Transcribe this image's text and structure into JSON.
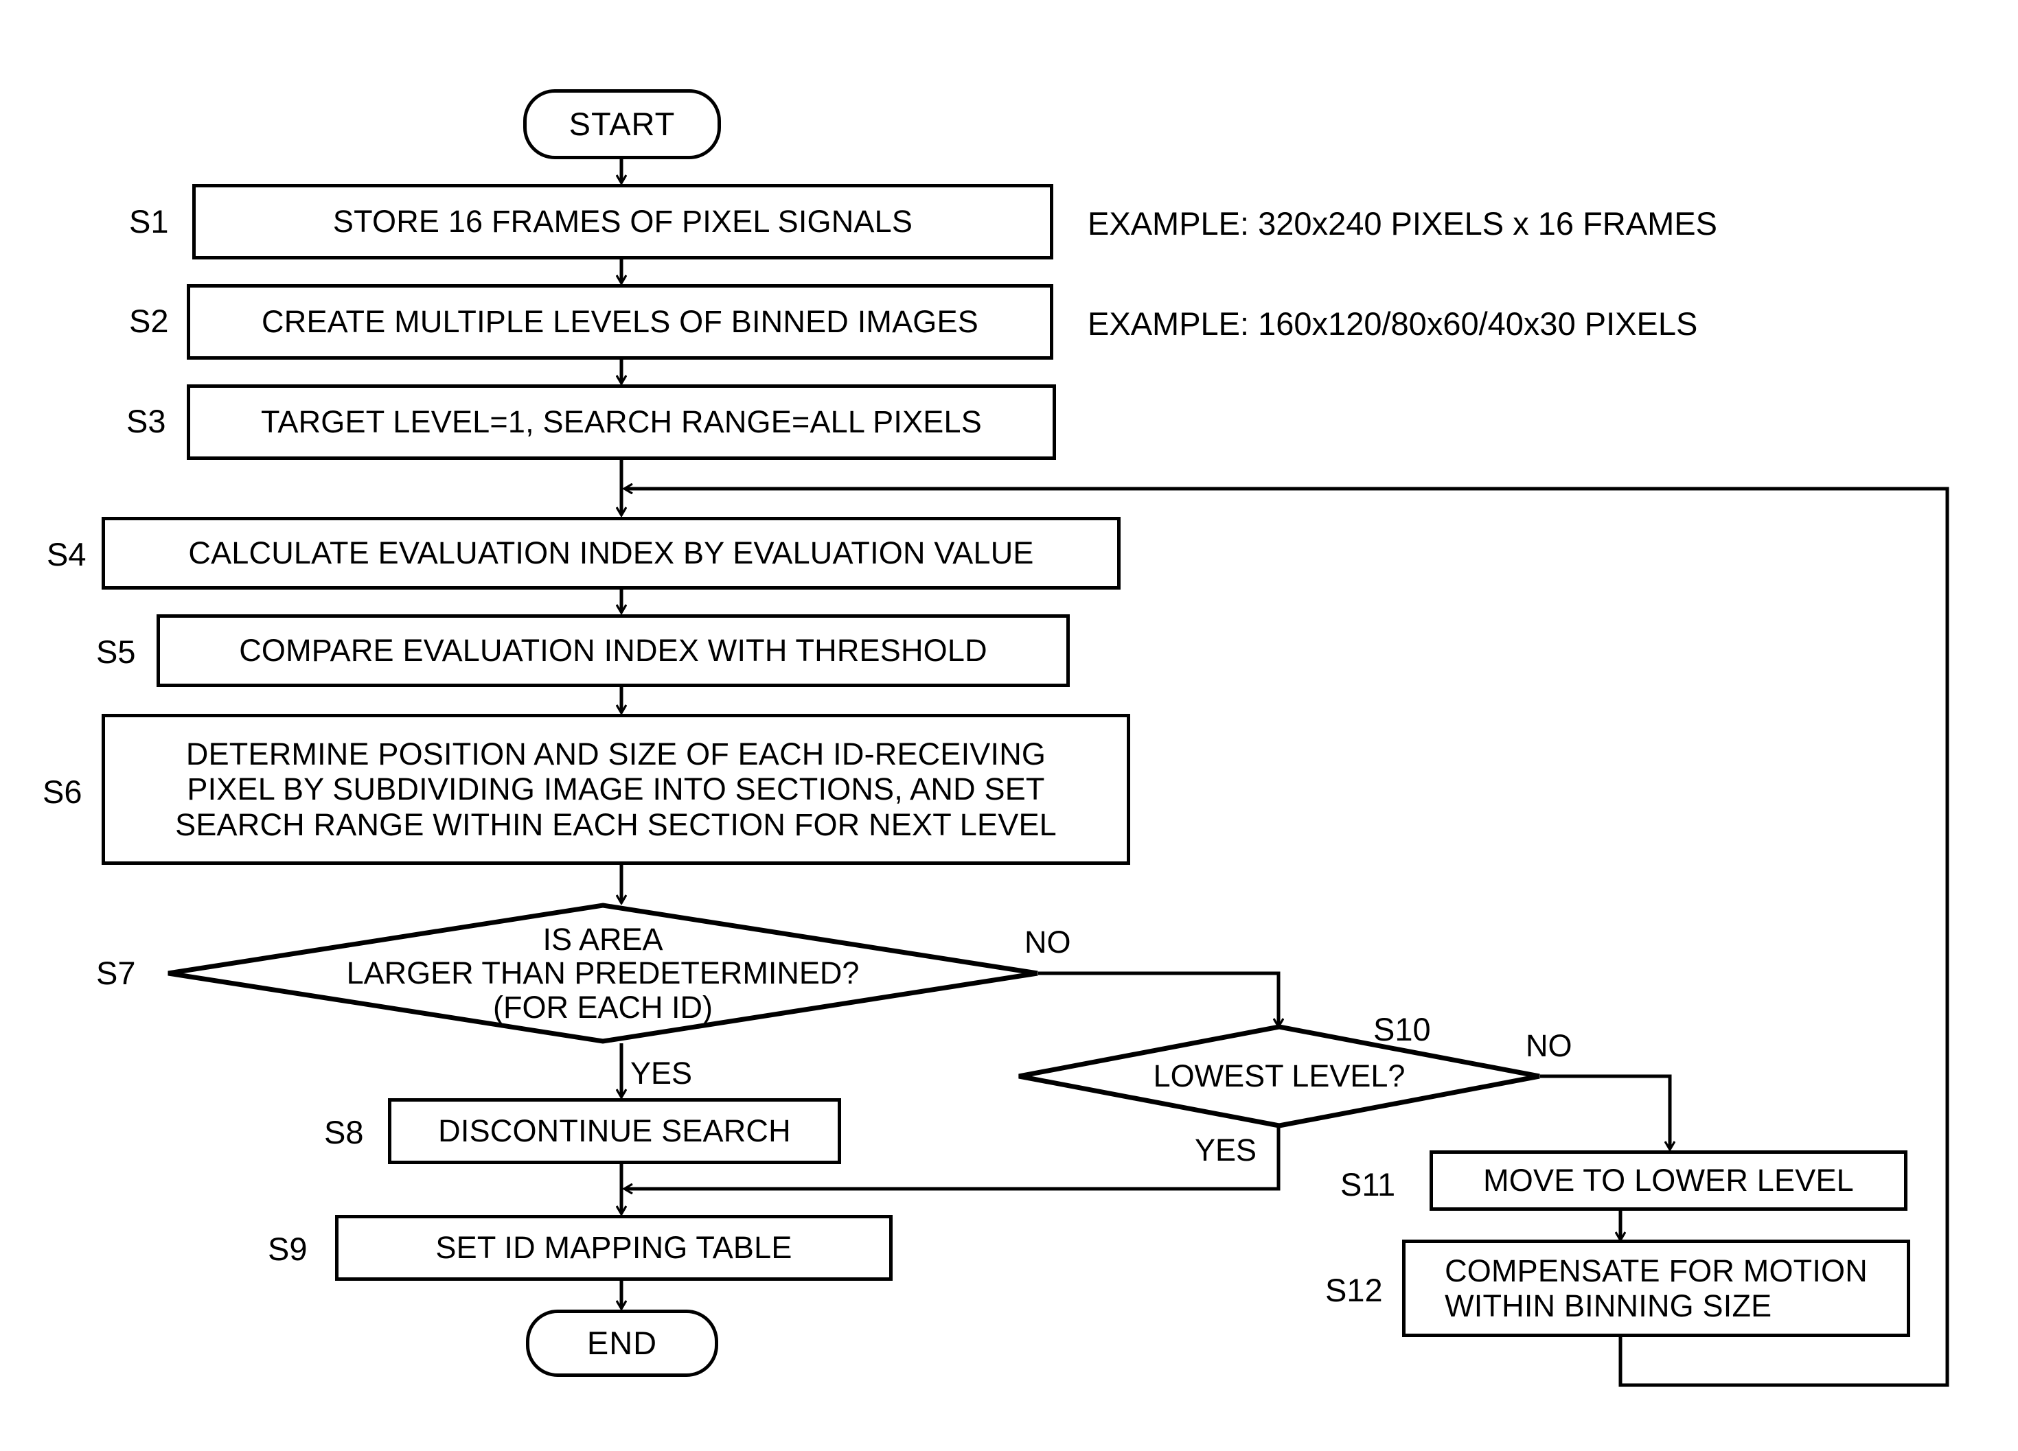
{
  "diagram": {
    "type": "flowchart",
    "title": "",
    "orientation": "top-to-bottom"
  },
  "terminators": {
    "start": "START",
    "end": "END"
  },
  "steps": [
    {
      "id": "S1",
      "tag": "S1",
      "text": "STORE 16 FRAMES OF PIXEL SIGNALS"
    },
    {
      "id": "S2",
      "tag": "S2",
      "text": "CREATE MULTIPLE LEVELS OF BINNED IMAGES"
    },
    {
      "id": "S3",
      "tag": "S3",
      "text": "TARGET LEVEL=1, SEARCH RANGE=ALL PIXELS"
    },
    {
      "id": "S4",
      "tag": "S4",
      "text": "CALCULATE EVALUATION INDEX BY EVALUATION VALUE"
    },
    {
      "id": "S5",
      "tag": "S5",
      "text": "COMPARE EVALUATION INDEX WITH THRESHOLD"
    },
    {
      "id": "S6",
      "tag": "S6",
      "line1": "DETERMINE POSITION AND SIZE OF EACH ID-RECEIVING",
      "line2": "PIXEL BY SUBDIVIDING IMAGE INTO SECTIONS, AND SET",
      "line3": "SEARCH RANGE WITHIN EACH SECTION FOR NEXT LEVEL"
    },
    {
      "id": "S8",
      "tag": "S8",
      "text": "DISCONTINUE SEARCH"
    },
    {
      "id": "S9",
      "tag": "S9",
      "text": "SET ID MAPPING TABLE"
    },
    {
      "id": "S11",
      "tag": "S11",
      "text": "MOVE TO LOWER LEVEL"
    },
    {
      "id": "S12",
      "tag": "S12",
      "line1": "COMPENSATE FOR MOTION",
      "line2": "WITHIN BINNING SIZE"
    }
  ],
  "decisions": [
    {
      "id": "S7",
      "tag": "S7",
      "line1": "IS AREA",
      "line2": "LARGER THAN PREDETERMINED?",
      "line3": "(FOR EACH ID)",
      "yes": "YES",
      "no": "NO"
    },
    {
      "id": "S10",
      "tag": "S10",
      "line1": "LOWEST LEVEL?",
      "yes": "YES",
      "no": "NO"
    }
  ],
  "annotations": [
    {
      "id": "note-s1",
      "text": "EXAMPLE: 320x240 PIXELS x 16 FRAMES"
    },
    {
      "id": "note-s2",
      "text": "EXAMPLE: 160x120/80x60/40x30 PIXELS"
    }
  ],
  "colors": {
    "line": "#000000",
    "fill": "#ffffff",
    "text": "#000000"
  }
}
